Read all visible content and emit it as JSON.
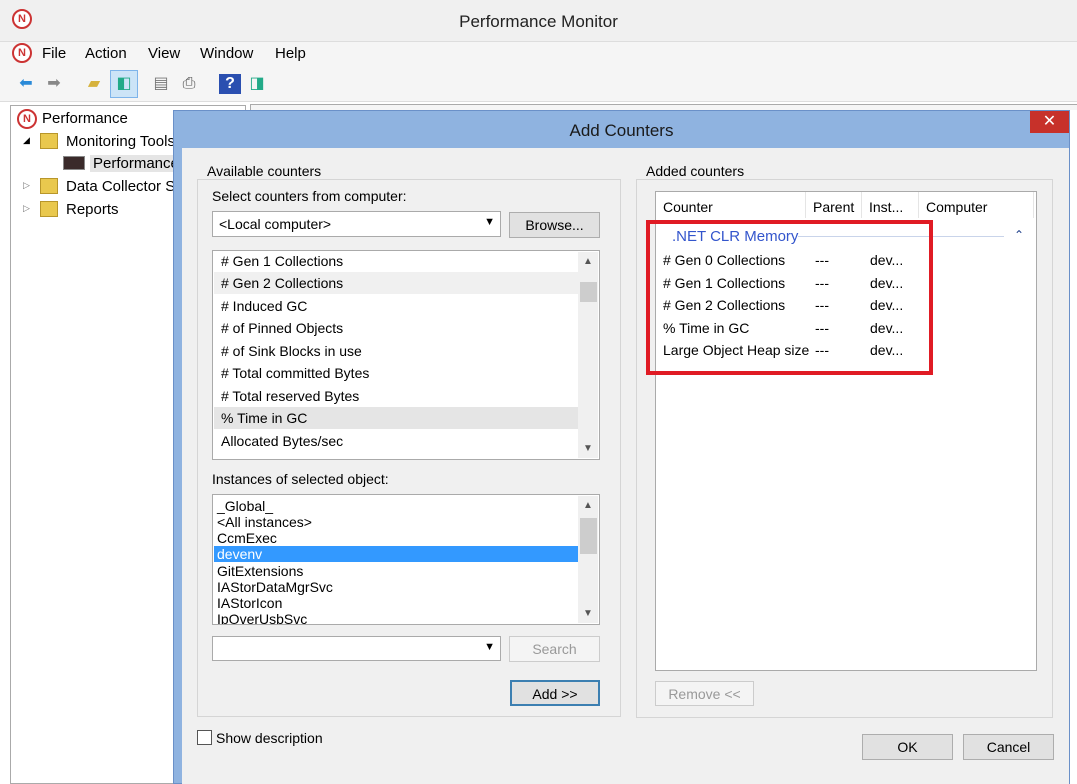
{
  "window": {
    "title": "Performance Monitor"
  },
  "menu": [
    "File",
    "Action",
    "View",
    "Window",
    "Help"
  ],
  "toolbar": {
    "icons": [
      "back-arrow-icon",
      "forward-arrow-icon",
      "folder-up-icon",
      "show-hide-console-tree-icon",
      "properties-icon",
      "print-icon",
      "help-icon",
      "show-action-pane-icon"
    ]
  },
  "tree": {
    "root": "Performance",
    "items": [
      {
        "label": "Monitoring Tools",
        "expanded": true
      },
      {
        "label": "Performance Monitor"
      },
      {
        "label": "Data Collector Sets"
      },
      {
        "label": "Reports"
      }
    ]
  },
  "dialog": {
    "title": "Add Counters",
    "close": "✕",
    "available_label": "Available counters",
    "select_label": "Select counters from computer:",
    "computer_value": "<Local computer>",
    "browse": "Browse...",
    "counters": [
      "# Gen 1 Collections",
      "# Gen 2 Collections",
      "# Induced GC",
      "# of Pinned Objects",
      "# of Sink Blocks in use",
      "# Total committed Bytes",
      "# Total reserved Bytes",
      "% Time in GC",
      "Allocated Bytes/sec"
    ],
    "instances_label": "Instances of selected object:",
    "instances": [
      "_Global_",
      "<All instances>",
      "CcmExec",
      "devenv",
      "GitExtensions",
      "IAStorDataMgrSvc",
      "IAStorIcon",
      "IpOverUsbSvc"
    ],
    "search_value": "",
    "search": "Search",
    "add": "Add >>",
    "show_description": "Show description",
    "added_label": "Added counters",
    "columns": [
      "Counter",
      "Parent",
      "Inst...",
      "Computer"
    ],
    "group": ".NET CLR Memory",
    "added": [
      {
        "counter": "# Gen 0 Collections",
        "parent": "---",
        "instance": "dev..."
      },
      {
        "counter": "# Gen 1 Collections",
        "parent": "---",
        "instance": "dev..."
      },
      {
        "counter": "# Gen 2 Collections",
        "parent": "---",
        "instance": "dev..."
      },
      {
        "counter": "% Time in GC",
        "parent": "---",
        "instance": "dev..."
      },
      {
        "counter": "Large Object Heap size",
        "parent": "---",
        "instance": "dev..."
      }
    ],
    "remove": "Remove <<",
    "ok": "OK",
    "cancel": "Cancel"
  },
  "colors": {
    "highlight": "#e01b24",
    "selected": "#3399ff",
    "group": "#3355cc"
  }
}
